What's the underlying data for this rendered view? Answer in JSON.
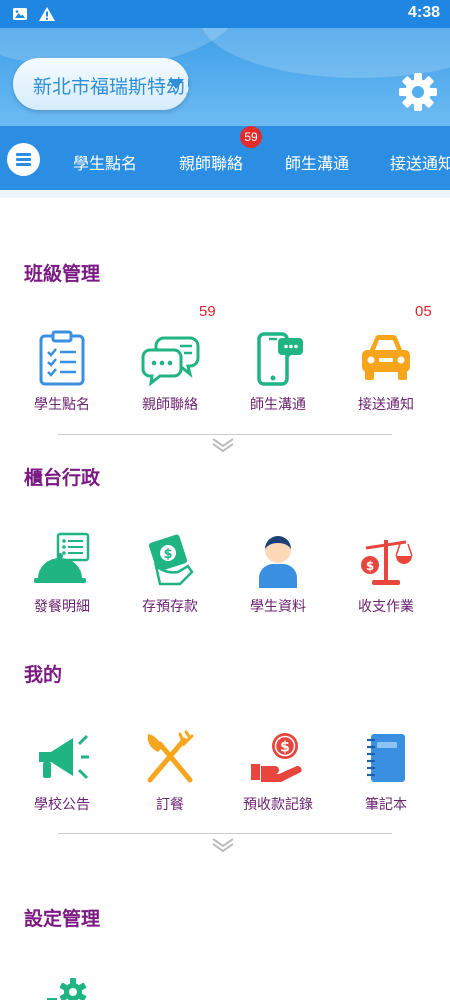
{
  "status_bar": {
    "time": "4:38"
  },
  "header": {
    "school_name": "新北市福瑞斯特幼兒園"
  },
  "tabs": [
    {
      "label": "學生點名"
    },
    {
      "label": "親師聯絡",
      "badge": "59"
    },
    {
      "label": "師生溝通"
    },
    {
      "label": "接送通知"
    }
  ],
  "sections": {
    "class_mgmt": {
      "title": "班級管理",
      "items": [
        {
          "label": "學生點名",
          "icon": "clipboard-check-icon"
        },
        {
          "label": "親師聯絡",
          "icon": "chat-bubbles-icon",
          "badge": "59"
        },
        {
          "label": "師生溝通",
          "icon": "phone-message-icon"
        },
        {
          "label": "接送通知",
          "icon": "car-icon",
          "badge": "05"
        }
      ]
    },
    "counter_admin": {
      "title": "櫃台行政",
      "items": [
        {
          "label": "發餐明細",
          "icon": "meal-cloche-icon"
        },
        {
          "label": "存預存款",
          "icon": "money-hand-icon"
        },
        {
          "label": "學生資料",
          "icon": "student-person-icon"
        },
        {
          "label": "收支作業",
          "icon": "balance-scale-icon"
        }
      ]
    },
    "mine": {
      "title": "我的",
      "items": [
        {
          "label": "學校公告",
          "icon": "megaphone-icon"
        },
        {
          "label": "訂餐",
          "icon": "fork-knife-icon"
        },
        {
          "label": "預收款記錄",
          "icon": "coin-hand-icon"
        },
        {
          "label": "筆記本",
          "icon": "notebook-icon"
        }
      ]
    },
    "settings_mgmt": {
      "title": "設定管理"
    }
  },
  "colors": {
    "primary_blue": "#2b8ee3",
    "section_title": "#7a1a82",
    "badge_red": "#d9262e",
    "icon_blue": "#3a8fe0",
    "icon_green": "#1fb482",
    "icon_orange": "#f7a51c",
    "icon_red": "#e8453c"
  }
}
